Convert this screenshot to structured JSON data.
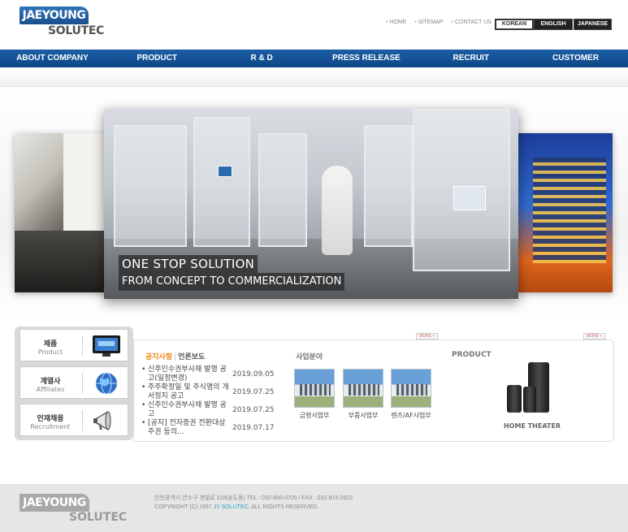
{
  "header": {
    "logo_top": "JAEYOUNG",
    "logo_bottom": "SOLUTEC",
    "util_links": [
      "HOME",
      "SITEMAP",
      "CONTACT US"
    ],
    "languages": [
      "KOREAN",
      "ENGLISH",
      "JAPANESE"
    ]
  },
  "nav": {
    "items": [
      "ABOUT COMPANY",
      "PRODUCT",
      "R & D",
      "PRESS RELEASE",
      "RECRUIT",
      "CUSTOMER"
    ]
  },
  "hero": {
    "line1": "ONE STOP SOLUTION",
    "line2": "FROM CONCEPT TO COMMERCIALIZATION"
  },
  "quick_links": [
    {
      "ko": "제품",
      "en": "Product",
      "icon": "monitor-icon"
    },
    {
      "ko": "계열사",
      "en": "Affiliates",
      "icon": "globe-icon"
    },
    {
      "ko": "인재채용",
      "en": "Recruitment",
      "icon": "megaphone-icon"
    }
  ],
  "news": {
    "tab_active": "공지사항",
    "tab_inactive": "언론보도",
    "more": "MORE +",
    "items": [
      {
        "title": "신주인수권부사채 발행 공고(일정변경)",
        "date": "2019.09.05"
      },
      {
        "title": "주주확정일 및 주식명의 개서정지 공고",
        "date": "2019.07.25"
      },
      {
        "title": "신주인수권부사채 발행 공고",
        "date": "2019.07.25"
      },
      {
        "title": "[공지] 전자증권 전환대상 주권 등의...",
        "date": "2019.07.17"
      }
    ]
  },
  "business": {
    "title": "사업분야",
    "items": [
      "금형사업부",
      "부품사업부",
      "렌즈/AF사업부"
    ]
  },
  "product": {
    "title": "PRODUCT",
    "more": "MORE +",
    "label": "HOME THEATER"
  },
  "footer": {
    "logo_top": "JAEYOUNG",
    "logo_bottom": "SOLUTEC",
    "address": "인천광역시 연수구 갯벌로 118(송도동)     TEL : 032-850-0700 / FAX : 032-815-2522",
    "copy_pre": "COPYRIGHT (C) 1997",
    "copy_brand": "JY SOLUTEC.",
    "copy_post": "ALL RIGHTS RESERVED."
  },
  "colors": {
    "brand_blue": "#1b5ea6",
    "news_accent": "#f08a1c"
  }
}
